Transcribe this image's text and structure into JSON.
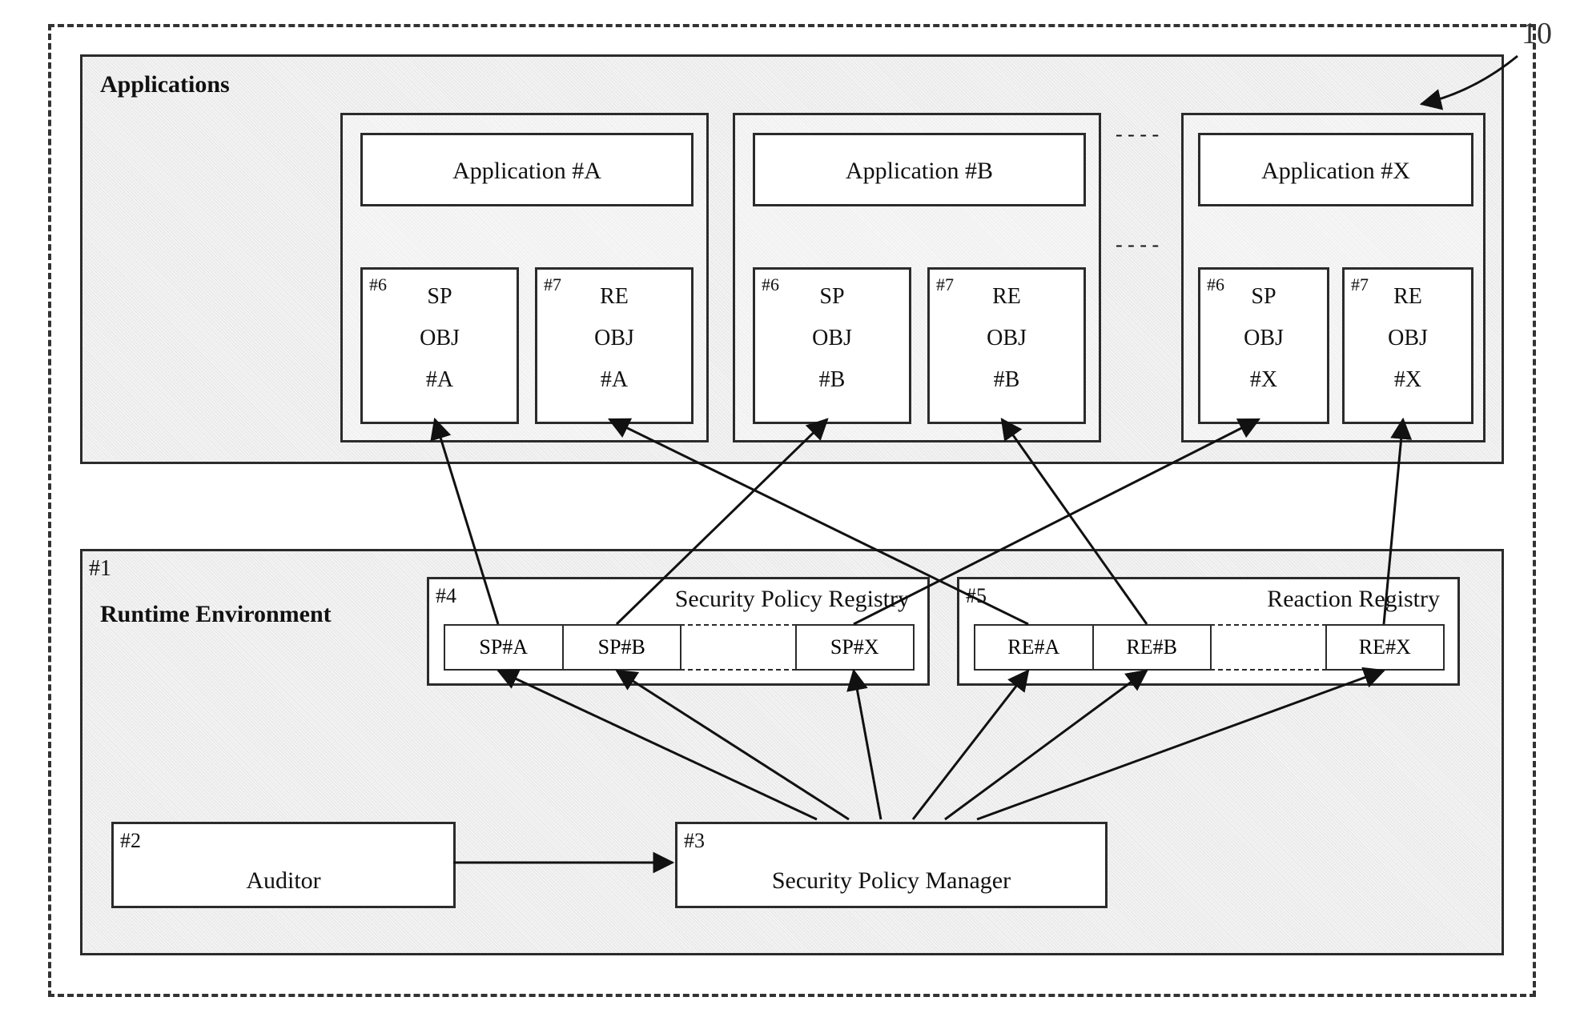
{
  "callout": {
    "number": "10"
  },
  "applications_panel": {
    "title": "Applications",
    "ellipsis_top": "- - - -",
    "ellipsis_mid": "- - - -",
    "apps": [
      {
        "title": "Application #A",
        "sp": {
          "tag": "#6",
          "l1": "SP",
          "l2": "OBJ",
          "l3": "#A"
        },
        "re": {
          "tag": "#7",
          "l1": "RE",
          "l2": "OBJ",
          "l3": "#A"
        }
      },
      {
        "title": "Application #B",
        "sp": {
          "tag": "#6",
          "l1": "SP",
          "l2": "OBJ",
          "l3": "#B"
        },
        "re": {
          "tag": "#7",
          "l1": "RE",
          "l2": "OBJ",
          "l3": "#B"
        }
      },
      {
        "title": "Application #X",
        "sp": {
          "tag": "#6",
          "l1": "SP",
          "l2": "OBJ",
          "l3": "#X"
        },
        "re": {
          "tag": "#7",
          "l1": "RE",
          "l2": "OBJ",
          "l3": "#X"
        }
      }
    ]
  },
  "runtime_panel": {
    "tag": "#1",
    "title": "Runtime Environment",
    "sp_registry": {
      "tag": "#4",
      "title": "Security Policy Registry",
      "cells": [
        "SP#A",
        "SP#B",
        "SP#X"
      ]
    },
    "re_registry": {
      "tag": "#5",
      "title": "Reaction Registry",
      "cells": [
        "RE#A",
        "RE#B",
        "RE#X"
      ]
    },
    "auditor": {
      "tag": "#2",
      "title": "Auditor"
    },
    "manager": {
      "tag": "#3",
      "title": "Security Policy Manager"
    }
  }
}
